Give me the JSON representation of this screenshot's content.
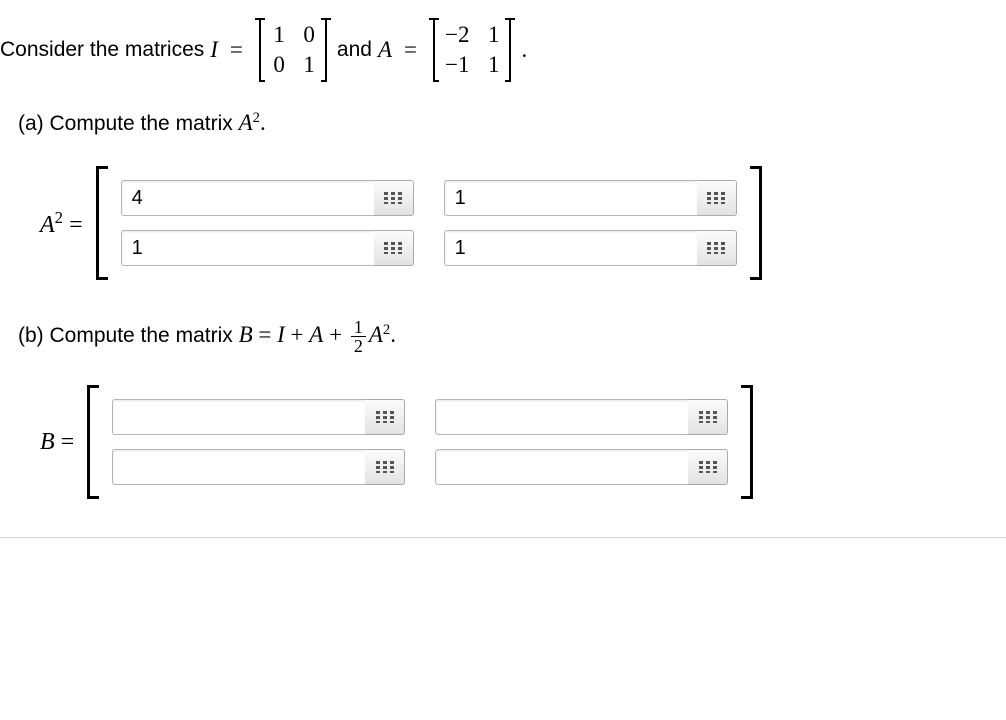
{
  "intro": {
    "prefix": "Consider the matrices ",
    "I_label": "I",
    "eq": "=",
    "and": " and ",
    "A_label": "A",
    "period": "."
  },
  "matrix_I": {
    "r1c1": "1",
    "r1c2": "0",
    "r2c1": "0",
    "r2c2": "1"
  },
  "matrix_A": {
    "r1c1": "−2",
    "r1c2": "1",
    "r2c1": "−1",
    "r2c2": "1"
  },
  "partA": {
    "label": "(a) Compute the matrix ",
    "expr": "A",
    "exp": "2",
    "period": "."
  },
  "A2": {
    "lhs_base": "A",
    "lhs_exp": "2",
    "eq": " =",
    "values": {
      "r1c1": "4",
      "r1c2": "1",
      "r2c1": "1",
      "r2c2": "1"
    }
  },
  "partB": {
    "label": "(b) Compute the matrix ",
    "B": "B",
    "eq1": " = ",
    "I": "I",
    "plus1": " + ",
    "A": "A",
    "plus2": " + ",
    "frac_n": "1",
    "frac_d": "2",
    "A2_base": "A",
    "A2_exp": "2",
    "period": "."
  },
  "B": {
    "lhs": "B",
    "eq": " =",
    "values": {
      "r1c1": "",
      "r1c2": "",
      "r2c1": "",
      "r2c2": ""
    }
  },
  "icons": {
    "keypad": "keypad-icon"
  }
}
